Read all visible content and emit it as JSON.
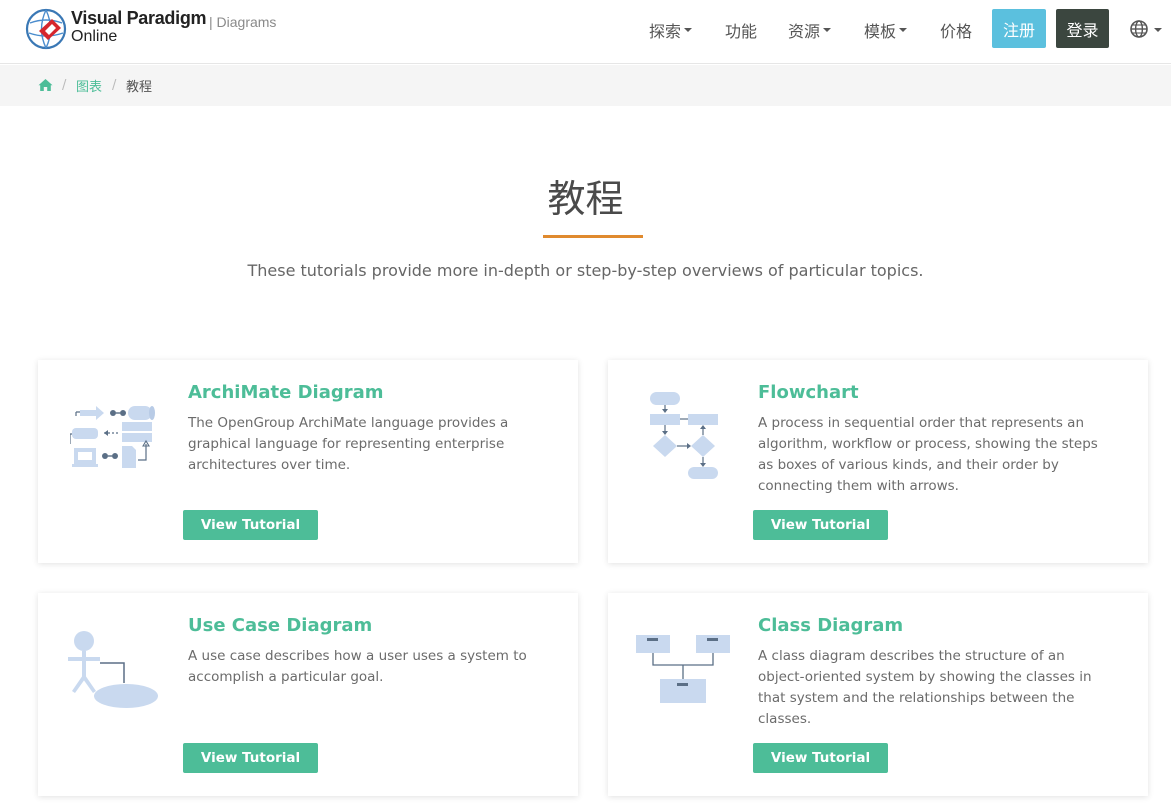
{
  "header": {
    "brand_line1": "Visual Paradigm",
    "brand_line2": "Online",
    "brand_section": "| Diagrams",
    "nav": [
      {
        "label": "探索",
        "has_dropdown": true
      },
      {
        "label": "功能",
        "has_dropdown": false
      },
      {
        "label": "资源",
        "has_dropdown": true
      },
      {
        "label": "模板",
        "has_dropdown": true
      },
      {
        "label": "价格",
        "has_dropdown": false
      }
    ],
    "signup_label": "注册",
    "login_label": "登录",
    "language_icon": "globe-icon",
    "colors": {
      "signup": "#5bc0de",
      "login": "#3b463f"
    }
  },
  "breadcrumb": {
    "home_icon": "home-icon",
    "items": [
      "图表",
      "教程"
    ],
    "separator": "/"
  },
  "hero": {
    "title": "教程",
    "subtitle": "These tutorials provide more in-depth or step-by-step overviews of particular topics.",
    "accent_color": "#e08a2e"
  },
  "cards": [
    {
      "title": "ArchiMate Diagram",
      "description": "The OpenGroup ArchiMate language provides a graphical language for representing enterprise architectures over time.",
      "button": "View Tutorial",
      "icon": "archimate-diagram-icon"
    },
    {
      "title": "Flowchart",
      "description": "A process in sequential order that represents an algorithm, workflow or process, showing the steps as boxes of various kinds, and their order by connecting them with arrows.",
      "button": "View Tutorial",
      "icon": "flowchart-icon"
    },
    {
      "title": "Use Case Diagram",
      "description": "A use case describes how a user uses a system to accomplish a particular goal.",
      "button": "View Tutorial",
      "icon": "use-case-diagram-icon"
    },
    {
      "title": "Class Diagram",
      "description": "A class diagram describes the structure of an object-oriented system by showing the classes in that system and the relationships between the classes.",
      "button": "View Tutorial",
      "icon": "class-diagram-icon"
    }
  ],
  "theme": {
    "accent_green": "#4dbd98",
    "illustration_blue": "#c9d9ef"
  }
}
